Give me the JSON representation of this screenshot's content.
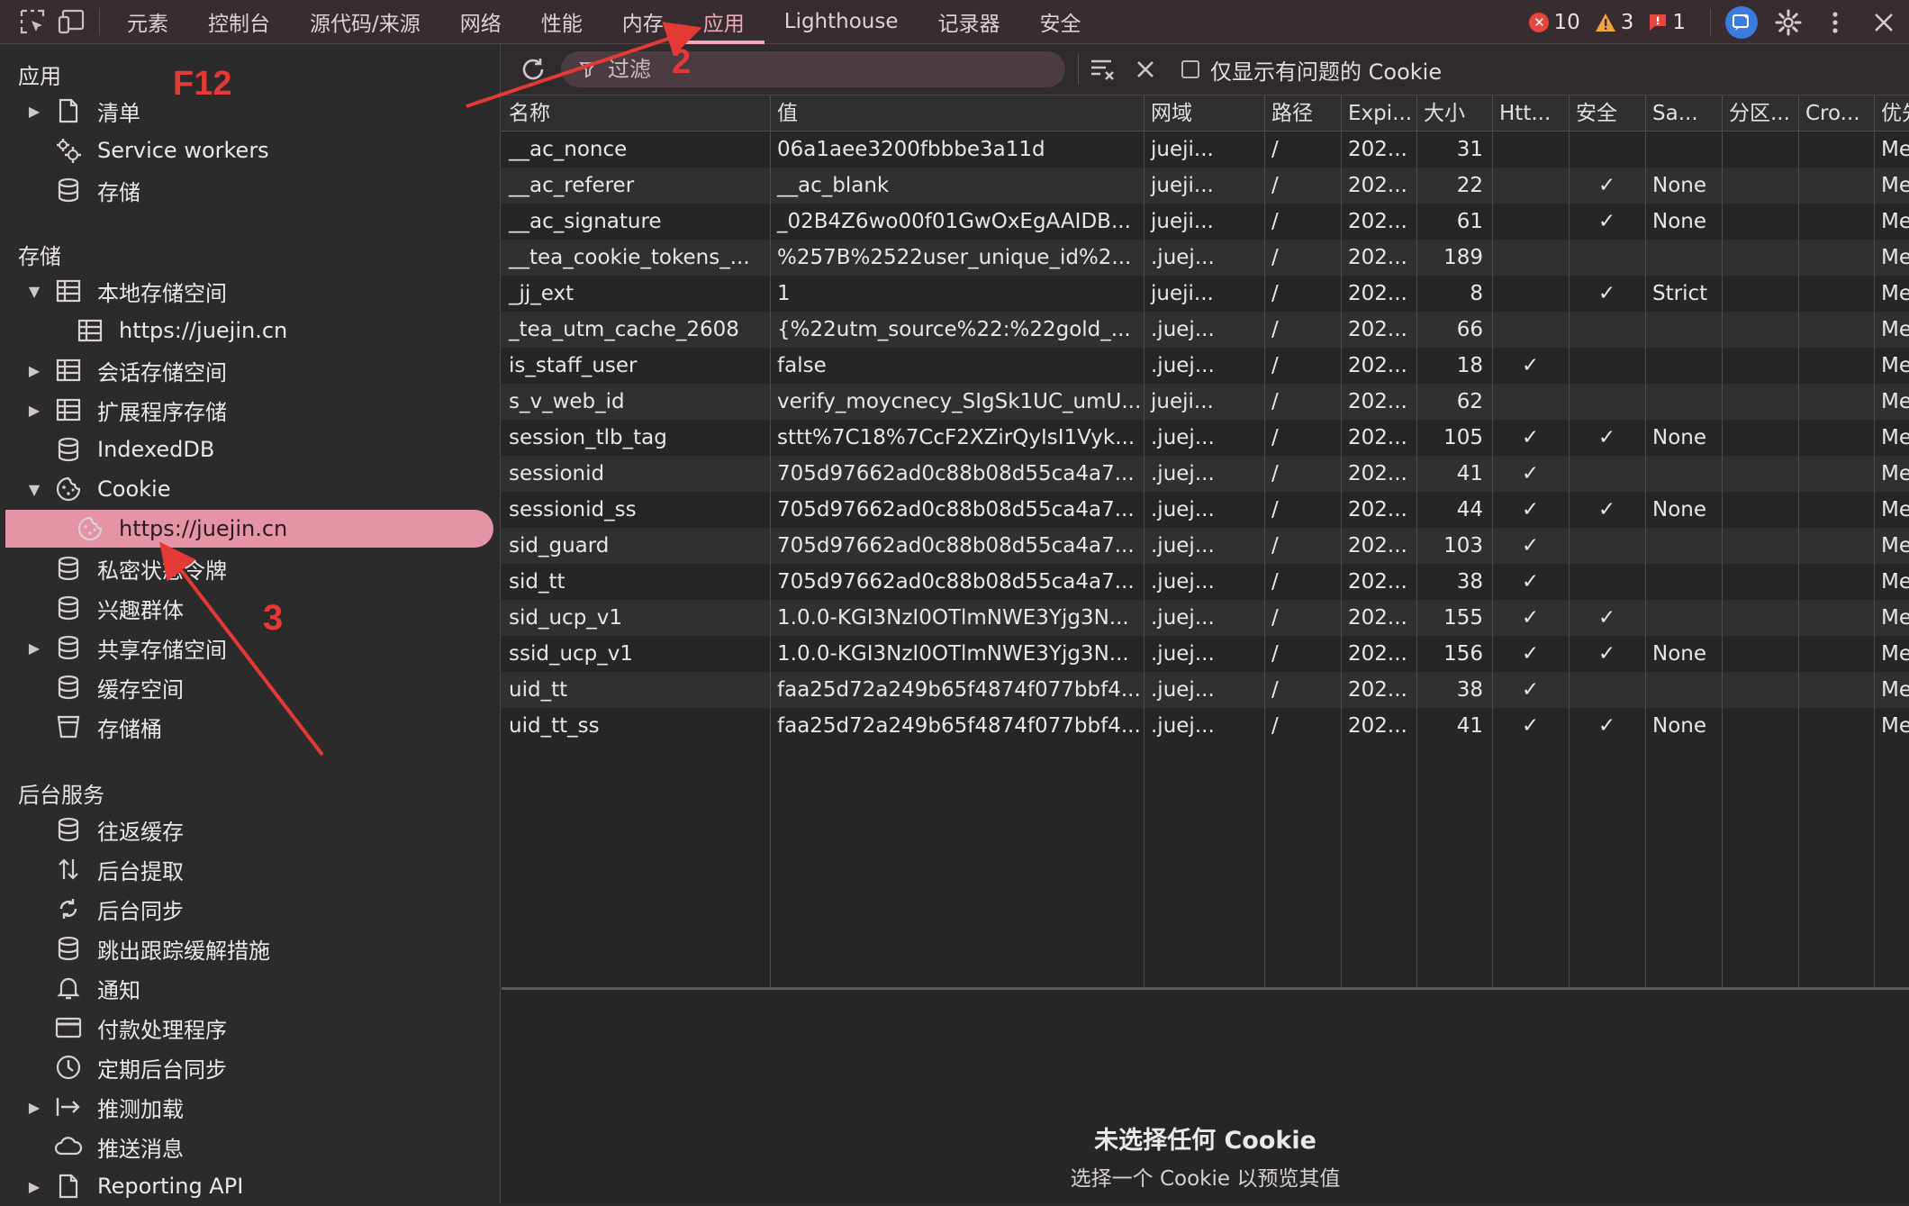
{
  "topbar": {
    "tabs": [
      {
        "label": "元素",
        "active": false
      },
      {
        "label": "控制台",
        "active": false
      },
      {
        "label": "源代码/来源",
        "active": false
      },
      {
        "label": "网络",
        "active": false
      },
      {
        "label": "性能",
        "active": false
      },
      {
        "label": "内存",
        "active": false
      },
      {
        "label": "应用",
        "active": true
      },
      {
        "label": "Lighthouse",
        "active": false
      },
      {
        "label": "记录器",
        "active": false
      },
      {
        "label": "安全",
        "active": false
      }
    ],
    "errors": "10",
    "warnings": "3",
    "issues": "1",
    "accent": "#f4a9bb"
  },
  "sidebar": {
    "sections": [
      {
        "title": "应用"
      },
      {
        "title": "存储"
      },
      {
        "title": "后台服务"
      }
    ],
    "app_items": [
      {
        "label": "清单",
        "icon": "document-icon",
        "arrow": "right"
      },
      {
        "label": "Service workers",
        "icon": "gears-icon"
      },
      {
        "label": "存储",
        "icon": "database-icon"
      }
    ],
    "storage_items": [
      {
        "label": "本地存储空间",
        "icon": "table-icon",
        "arrow": "down"
      },
      {
        "label": "https://juejin.cn",
        "icon": "table-icon"
      },
      {
        "label": "会话存储空间",
        "icon": "table-icon",
        "arrow": "right"
      },
      {
        "label": "扩展程序存储",
        "icon": "table-icon",
        "arrow": "right"
      },
      {
        "label": "IndexedDB",
        "icon": "database-icon"
      },
      {
        "label": "Cookie",
        "icon": "cookie-icon",
        "arrow": "down"
      },
      {
        "label": "https://juejin.cn",
        "icon": "cookie-icon",
        "selected": true
      },
      {
        "label": "私密状态令牌",
        "icon": "database-icon"
      },
      {
        "label": "兴趣群体",
        "icon": "database-icon"
      },
      {
        "label": "共享存储空间",
        "icon": "database-icon",
        "arrow": "right"
      },
      {
        "label": "缓存空间",
        "icon": "database-icon"
      },
      {
        "label": "存储桶",
        "icon": "bucket-icon"
      }
    ],
    "background_items": [
      {
        "label": "往返缓存",
        "icon": "database-icon"
      },
      {
        "label": "后台提取",
        "icon": "updown-arrows-icon"
      },
      {
        "label": "后台同步",
        "icon": "sync-icon"
      },
      {
        "label": "跳出跟踪缓解措施",
        "icon": "database-icon"
      },
      {
        "label": "通知",
        "icon": "bell-icon"
      },
      {
        "label": "付款处理程序",
        "icon": "card-icon"
      },
      {
        "label": "定期后台同步",
        "icon": "clock-icon"
      },
      {
        "label": "推测加载",
        "icon": "arrow-bar-icon",
        "arrow": "right"
      },
      {
        "label": "推送消息",
        "icon": "cloud-icon"
      },
      {
        "label": "Reporting API",
        "icon": "document-icon",
        "arrow": "right"
      }
    ],
    "selected_bg": "#e593a6"
  },
  "toolbar": {
    "filter_placeholder": "过滤",
    "issues_only_label": "仅显示有问题的 Cookie"
  },
  "table": {
    "headers": [
      "名称",
      "值",
      "网域",
      "路径",
      "Expi...",
      "大小",
      "Htt...",
      "安全",
      "Sa...",
      "分区...",
      "Cro...",
      "优先..."
    ],
    "rows": [
      [
        "__ac_nonce",
        "06a1aee3200fbbbe3a11d",
        "jueji...",
        "/",
        "202...",
        "31",
        "",
        "",
        "",
        "",
        "",
        "Med..."
      ],
      [
        "__ac_referer",
        "__ac_blank",
        "jueji...",
        "/",
        "202...",
        "22",
        "",
        "✓",
        "None",
        "",
        "",
        "Med..."
      ],
      [
        "__ac_signature",
        "_02B4Z6wo00f01GwOxEgAAIDB...",
        "jueji...",
        "/",
        "202...",
        "61",
        "",
        "✓",
        "None",
        "",
        "",
        "Med..."
      ],
      [
        "__tea_cookie_tokens_...",
        "%257B%2522user_unique_id%2...",
        ".juej...",
        "/",
        "202...",
        "189",
        "",
        "",
        "",
        "",
        "",
        "Med..."
      ],
      [
        "_jj_ext",
        "1",
        "jueji...",
        "/",
        "202...",
        "8",
        "",
        "✓",
        "Strict",
        "",
        "",
        "Med..."
      ],
      [
        "_tea_utm_cache_2608",
        "{%22utm_source%22:%22gold_...",
        ".juej...",
        "/",
        "202...",
        "66",
        "",
        "",
        "",
        "",
        "",
        "Med..."
      ],
      [
        "is_staff_user",
        "false",
        ".juej...",
        "/",
        "202...",
        "18",
        "✓",
        "",
        "",
        "",
        "",
        "Med..."
      ],
      [
        "s_v_web_id",
        "verify_moycnecy_SIgSk1UC_umU...",
        "jueji...",
        "/",
        "202...",
        "62",
        "",
        "",
        "",
        "",
        "",
        "Med..."
      ],
      [
        "session_tlb_tag",
        "sttt%7C18%7CcF2XZirQyIsI1Vyk...",
        ".juej...",
        "/",
        "202...",
        "105",
        "✓",
        "✓",
        "None",
        "",
        "",
        "Med..."
      ],
      [
        "sessionid",
        "705d97662ad0c88b08d55ca4a7...",
        ".juej...",
        "/",
        "202...",
        "41",
        "✓",
        "",
        "",
        "",
        "",
        "Med..."
      ],
      [
        "sessionid_ss",
        "705d97662ad0c88b08d55ca4a7...",
        ".juej...",
        "/",
        "202...",
        "44",
        "✓",
        "✓",
        "None",
        "",
        "",
        "Med..."
      ],
      [
        "sid_guard",
        "705d97662ad0c88b08d55ca4a7...",
        ".juej...",
        "/",
        "202...",
        "103",
        "✓",
        "",
        "",
        "",
        "",
        "Med..."
      ],
      [
        "sid_tt",
        "705d97662ad0c88b08d55ca4a7...",
        ".juej...",
        "/",
        "202...",
        "38",
        "✓",
        "",
        "",
        "",
        "",
        "Med..."
      ],
      [
        "sid_ucp_v1",
        "1.0.0-KGI3NzI0OTlmNWE3Yjg3N...",
        ".juej...",
        "/",
        "202...",
        "155",
        "✓",
        "✓",
        "",
        "",
        "",
        "Med..."
      ],
      [
        "ssid_ucp_v1",
        "1.0.0-KGI3NzI0OTlmNWE3Yjg3N...",
        ".juej...",
        "/",
        "202...",
        "156",
        "✓",
        "✓",
        "None",
        "",
        "",
        "Med..."
      ],
      [
        "uid_tt",
        "faa25d72a249b65f4874f077bbf4...",
        ".juej...",
        "/",
        "202...",
        "38",
        "✓",
        "",
        "",
        "",
        "",
        "Med..."
      ],
      [
        "uid_tt_ss",
        "faa25d72a249b65f4874f077bbf4...",
        ".juej...",
        "/",
        "202...",
        "41",
        "✓",
        "✓",
        "None",
        "",
        "",
        "Med..."
      ]
    ]
  },
  "preview": {
    "title": "未选择任何 Cookie",
    "subtitle": "选择一个 Cookie 以预览其值"
  },
  "annotations": {
    "f12": "F12",
    "step2": "2",
    "step3": "3",
    "color": "#e53935"
  }
}
